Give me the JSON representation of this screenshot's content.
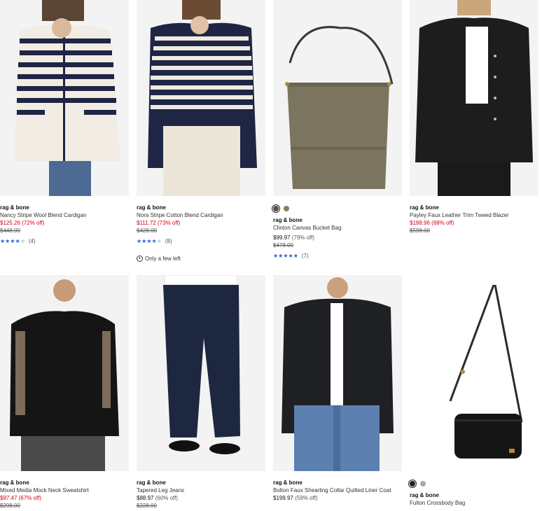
{
  "products": [
    {
      "brand": "rag & bone",
      "name": "Nancy Stripe Wool Blend Cardigan",
      "price": "$125.26",
      "off": "(72% off)",
      "orig": "$448.00",
      "rating_count": "(4)",
      "stars": 4
    },
    {
      "brand": "rag & bone",
      "name": "Nora Stripe Cotton Blend Cardigan",
      "price": "$111.72",
      "off": "(73% off)",
      "orig": "$428.00",
      "rating_count": "(8)",
      "stars": 4,
      "note": "Only a few left"
    },
    {
      "brand": "rag & bone",
      "name": "Clinton Canvas Bucket Bag",
      "price": "$99.97",
      "off": "(79% off)",
      "orig": "$478.00",
      "rating_count": "(7)",
      "stars": 5,
      "swatches": [
        "#5a5143",
        "#8b7d55"
      ]
    },
    {
      "brand": "rag & bone",
      "name": "Payley Faux Leather Trim Tweed Blazer",
      "price": "$188.96",
      "off": "(68% off)",
      "orig": "$598.00"
    },
    {
      "brand": "rag & bone",
      "name": "Mixed Media Mock Neck Sweatshirt",
      "price": "$97.47",
      "off": "(67% off)",
      "orig": "$298.00"
    },
    {
      "brand": "rag & bone",
      "name": "Tapered Leg Jeans",
      "price": "$88.97",
      "off": "(60% off)",
      "orig": "$228.00"
    },
    {
      "brand": "rag & bone",
      "name": "Bolton Faux Shearling Collar Quilted Liner Coat",
      "price": "$199.97",
      "off": "(59% off)"
    },
    {
      "brand": "rag & bone",
      "name": "Fulton Crossbody Bag",
      "swatches": [
        "#222222",
        "#b7a697"
      ]
    }
  ],
  "colors": {
    "sale": "#d0021b",
    "star": "#2463d1"
  }
}
